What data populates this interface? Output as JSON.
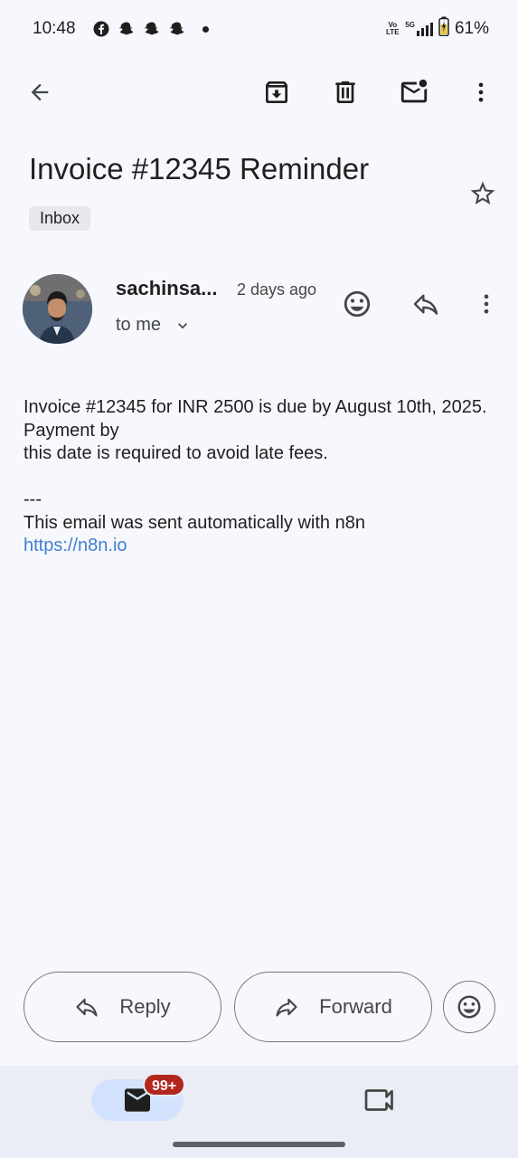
{
  "status_bar": {
    "time": "10:48",
    "notification_icons": [
      "facebook-icon",
      "snapchat-icon",
      "snapchat-icon",
      "snapchat-icon"
    ],
    "volte_top": "Vo",
    "volte_bottom": "LTE",
    "network": "5G",
    "battery": "61%"
  },
  "toolbar": {
    "icons": [
      "back-arrow-icon",
      "archive-icon",
      "trash-icon",
      "mark-unread-icon",
      "more-vert-icon"
    ]
  },
  "email": {
    "subject": "Invoice #12345 Reminder",
    "label": "Inbox",
    "sender": "sachinsa...",
    "time": "2 days ago",
    "recipient": "to me",
    "body": {
      "line1": "Invoice #12345 for INR 2500 is due by August 10th, 2025. Payment by",
      "line2": "this date is required to avoid late fees.",
      "separator": "---",
      "footer": "This email was sent automatically with n8n",
      "link": "https://n8n.io"
    }
  },
  "actions": {
    "reply": "Reply",
    "forward": "Forward"
  },
  "bottom_nav": {
    "mail_badge": "99+"
  },
  "colors": {
    "background": "#f7f8fd",
    "link": "#3f7fd0",
    "badge": "#b3261e",
    "nav_active": "#d3e3fd"
  }
}
